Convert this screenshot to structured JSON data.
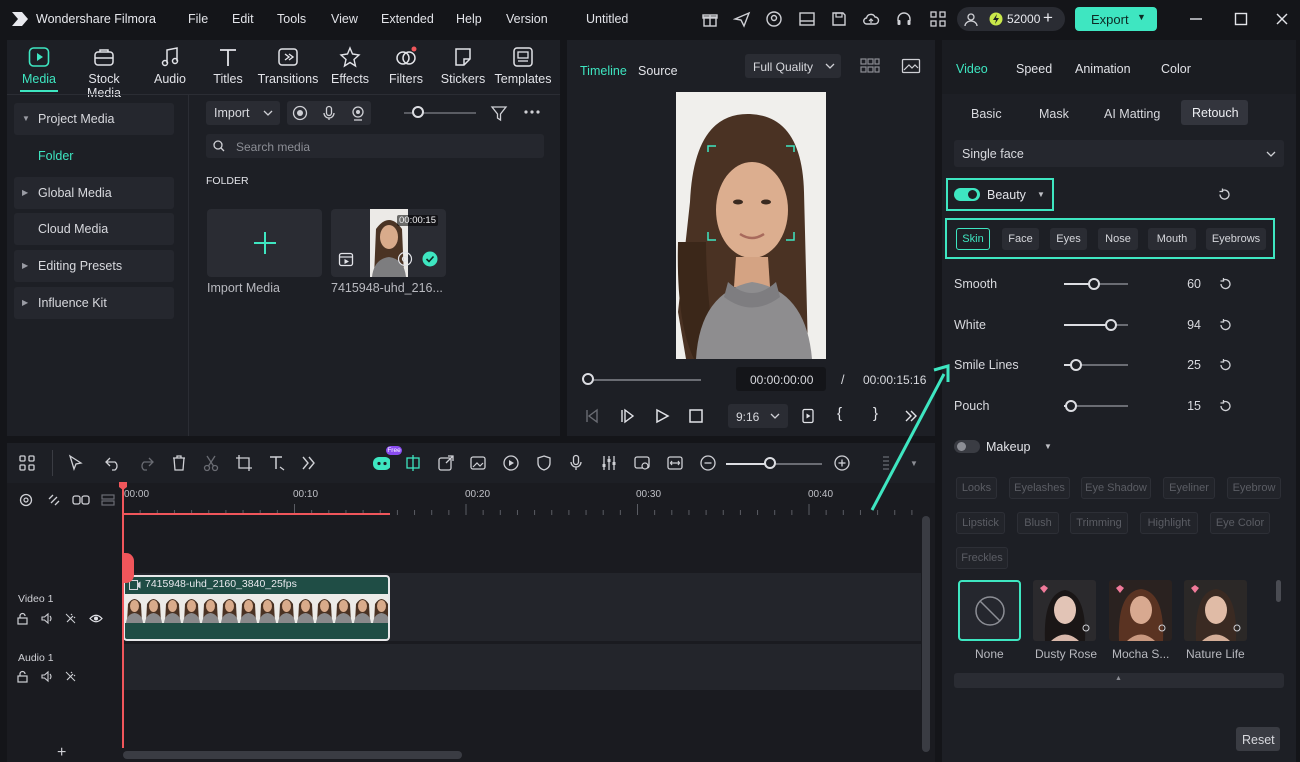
{
  "app": {
    "name": "Wondershare Filmora",
    "project": "Untitled",
    "credits": "52000"
  },
  "menu": [
    "File",
    "Edit",
    "Tools",
    "View",
    "Extended",
    "Help",
    "Version"
  ],
  "export_label": "Export",
  "toolbar": [
    {
      "label": "Media",
      "icon": "media-icon"
    },
    {
      "label": "Stock Media",
      "icon": "stock-media-icon"
    },
    {
      "label": "Audio",
      "icon": "audio-icon"
    },
    {
      "label": "Titles",
      "icon": "titles-icon"
    },
    {
      "label": "Transitions",
      "icon": "transitions-icon"
    },
    {
      "label": "Effects",
      "icon": "effects-icon"
    },
    {
      "label": "Filters",
      "icon": "filters-icon"
    },
    {
      "label": "Stickers",
      "icon": "stickers-icon"
    },
    {
      "label": "Templates",
      "icon": "templates-icon"
    }
  ],
  "sidebar": {
    "project_media": "Project Media",
    "folder": "Folder",
    "items": [
      "Global Media",
      "Cloud Media",
      "Editing Presets",
      "Influence Kit"
    ]
  },
  "media": {
    "import_label": "Import",
    "search_placeholder": "Search media",
    "folder_heading": "FOLDER",
    "import_tile": "Import Media",
    "clip_name": "7415948-uhd_216...",
    "clip_duration": "00:00:15"
  },
  "preview": {
    "tab_timeline": "Timeline",
    "tab_source": "Source",
    "quality": "Full Quality",
    "current_time": "00:00:00:00",
    "separator": "/",
    "total_time": "00:00:15:16",
    "aspect": "9:16",
    "bracket_open": "{",
    "bracket_close": "}"
  },
  "inspector": {
    "tabs": [
      "Video",
      "Speed",
      "Animation",
      "Color"
    ],
    "subtabs": [
      "Basic",
      "Mask",
      "AI Matting",
      "Retouch"
    ],
    "face_mode": "Single face",
    "beauty_label": "Beauty",
    "beauty_tabs": [
      "Skin",
      "Face",
      "Eyes",
      "Nose",
      "Mouth",
      "Eyebrows"
    ],
    "sliders": [
      {
        "label": "Smooth",
        "value": 60
      },
      {
        "label": "White",
        "value": 94
      },
      {
        "label": "Smile Lines",
        "value": 25
      },
      {
        "label": "Pouch",
        "value": 15
      }
    ],
    "makeup_label": "Makeup",
    "makeup_row1": [
      "Looks",
      "Eyelashes",
      "Eye Shadow",
      "Eyeliner",
      "Eyebrow"
    ],
    "makeup_row2": [
      "Lipstick",
      "Blush",
      "Trimming",
      "Highlight",
      "Eye Color"
    ],
    "makeup_row3": [
      "Freckles"
    ],
    "presets": [
      "None",
      "Dusty Rose",
      "Mocha S...",
      "Nature Life"
    ],
    "reset_label": "Reset"
  },
  "timeline": {
    "free_badge": "Free",
    "ruler": [
      "00:00",
      "00:10",
      "00:20",
      "00:30",
      "00:40"
    ],
    "video_track": "Video 1",
    "audio_track": "Audio 1",
    "clip_label": "7415948-uhd_2160_3840_25fps",
    "add_track": "+"
  },
  "colors": {
    "accent": "#3ee6c1",
    "export_bg": "#3ee6c1",
    "playhead": "#f0565b",
    "clip_border": "#e8e8ea",
    "clip_bg": "#1f4d45"
  }
}
